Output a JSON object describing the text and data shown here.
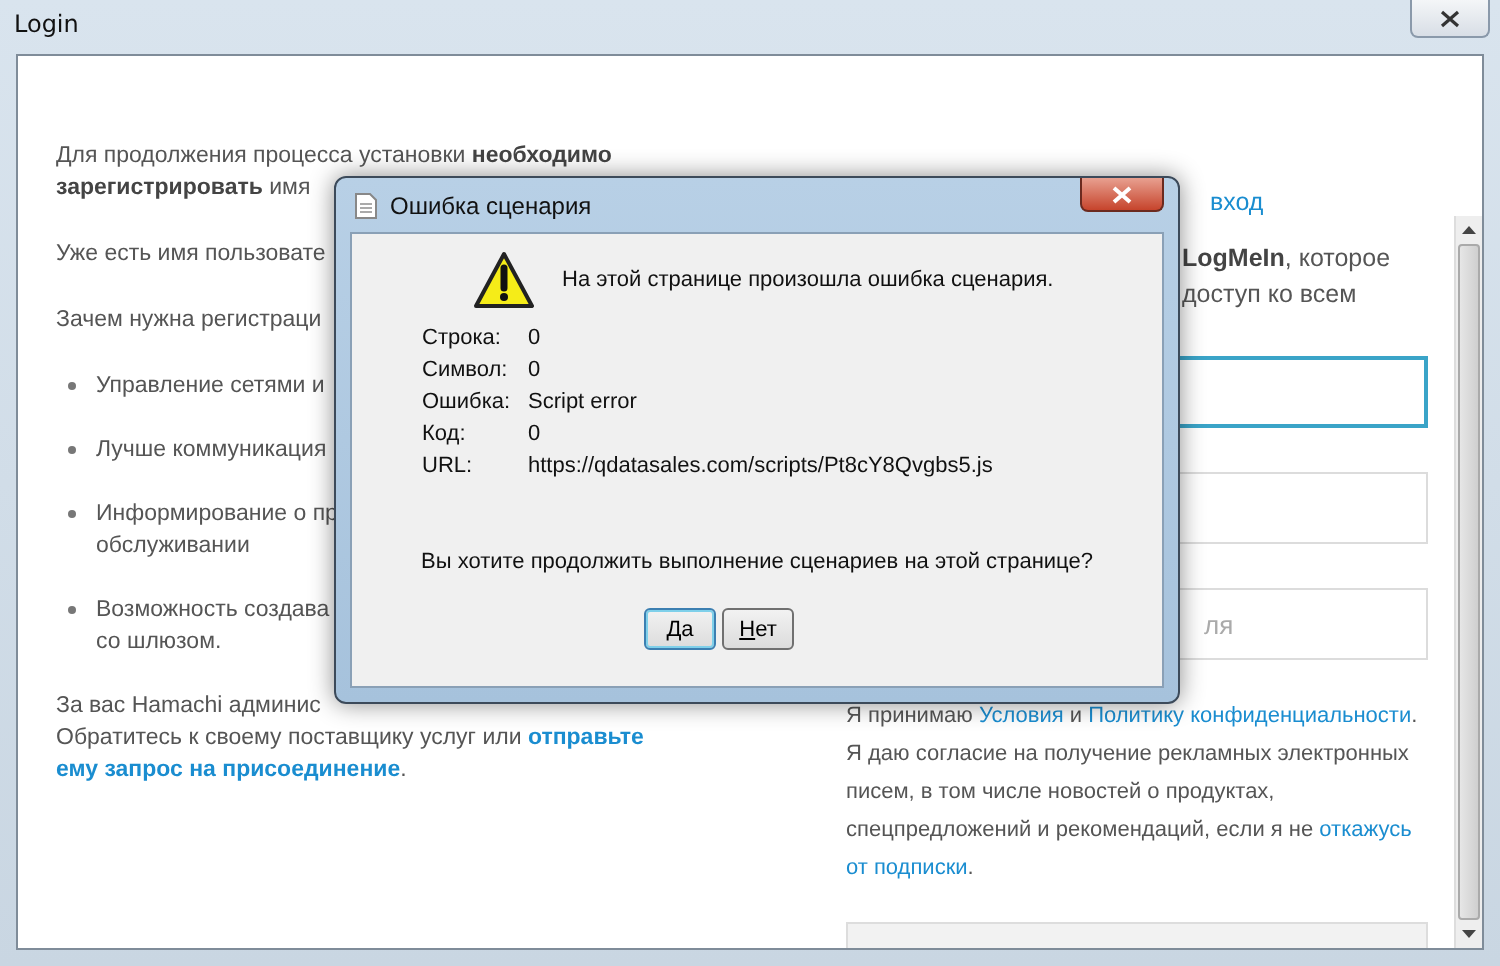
{
  "window": {
    "title": "Login"
  },
  "left": {
    "intro": [
      "Для продолжения процесса установки **необходимо**",
      "**зарегистрировать** имя"
    ],
    "have_account": "Уже есть имя пользовате",
    "why": "Зачем нужна регистраци",
    "benefits": [
      [
        "Управление сетями и"
      ],
      [
        "Лучше коммуникация"
      ],
      [
        "Информирование о пр",
        "обслуживании"
      ],
      [
        "Возможность создава",
        "со шлюзом."
      ]
    ],
    "admin": {
      "line_1": "За вас Hamachi админис",
      "line_2": "Обратитесь к своему поставщику услуг или",
      "link_1": "отправьте",
      "link_2": "ему запрос на присоединение",
      "end": "."
    }
  },
  "right": {
    "login_link": "вход",
    "about": [
      "**LogMeIn**, которое",
      "доступ ко всем"
    ],
    "fields": [
      {
        "focused": true
      },
      {
        "focused": false
      },
      {
        "focused": false,
        "placeholder": "ля"
      }
    ],
    "consent": [
      [
        {
          "kind": "text",
          "text": "Я принимаю "
        },
        {
          "kind": "link",
          "text": "Условия"
        },
        {
          "kind": "text",
          "text": " и "
        },
        {
          "kind": "link",
          "text": "Политику конфиденциальности"
        },
        {
          "kind": "text",
          "text": "."
        }
      ],
      [
        {
          "kind": "text",
          "text": "Я даю согласие на получение рекламных электронных писем, в том числе новостей о продуктах, спецпредложений и рекомендаций, если я не "
        },
        {
          "kind": "link",
          "text": "откажусь"
        },
        {
          "kind": "link",
          "text": "от подписки"
        },
        {
          "kind": "text",
          "text": "."
        }
      ]
    ]
  },
  "dialog": {
    "title": "Ошибка сценария",
    "message": "На этой странице произошла ошибка сценария.",
    "details": [
      {
        "label": "Строка:",
        "value": "0"
      },
      {
        "label": "Символ:",
        "value": "0"
      },
      {
        "label": "Ошибка:",
        "value": "Script error"
      },
      {
        "label": "Код:",
        "value": "0"
      },
      {
        "label": "URL:",
        "value": "https://qdatasales.com/scripts/Pt8cY8Qvgbs5.js"
      }
    ],
    "question": "Вы хотите продолжить выполнение сценариев на этой странице?",
    "buttons": [
      {
        "label": "Да",
        "selected": true
      },
      {
        "label": "Нет",
        "selected": false
      }
    ]
  }
}
